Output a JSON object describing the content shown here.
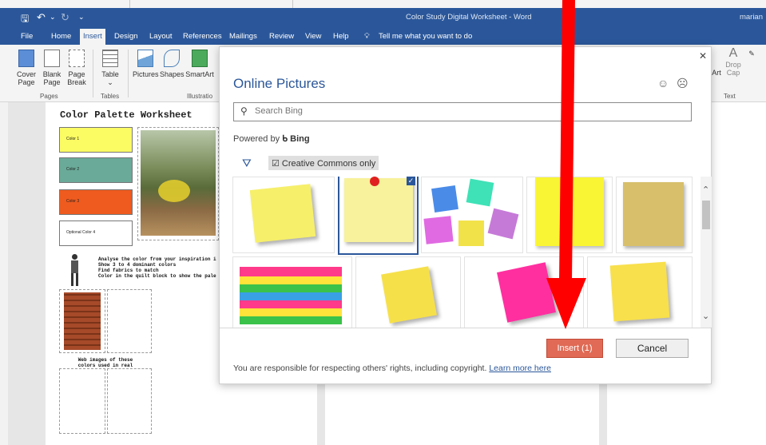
{
  "window": {
    "title": "Color Study Digital Worksheet  -  Word",
    "user": "marian"
  },
  "menu": {
    "tabs": [
      "File",
      "Home",
      "Insert",
      "Design",
      "Layout",
      "References",
      "Mailings",
      "Review",
      "View",
      "Help"
    ],
    "active": "Insert",
    "tell_me": "Tell me what you want to do"
  },
  "ribbon": {
    "cover_page": "Cover\nPage",
    "blank_page": "Blank\nPage",
    "page_break": "Page\nBreak",
    "table": "Table",
    "pictures": "Pictures",
    "shapes": "Shapes",
    "smartart": "SmartArt",
    "group_pages": "Pages",
    "group_tables": "Tables",
    "group_illustrations": "Illustratio",
    "right_art": "Art",
    "drop_cap": "Drop\nCap",
    "group_text": "Text"
  },
  "document": {
    "worksheet_title": "Color Palette Worksheet",
    "swatches": [
      {
        "label": "Color 1",
        "color": "#fbfb63"
      },
      {
        "label": "Color 2",
        "color": "#6aaa98"
      },
      {
        "label": "Color 3",
        "color": "#ef5b1f"
      },
      {
        "label": "Optional Color 4",
        "color": "#ffffff"
      }
    ],
    "instructions": [
      "Analyse the color from your inspiration i",
      "Show 3 to 4 dominant colors",
      "Find fabrics to match",
      "Color in the quilt block to show the pale"
    ],
    "web_images_caption": "Web images of these\ncolors used in real"
  },
  "dialog": {
    "title": "Online Pictures",
    "search_placeholder": "Search Bing",
    "powered_by": "Powered by",
    "bing": "Bing",
    "filter_chip": "Creative Commons only",
    "insert_button": "Insert (1)",
    "cancel_button": "Cancel",
    "footer": "You are responsible for respecting others' rights, including copyright.",
    "learn_more": "Learn more here"
  },
  "colors": {
    "word_blue": "#2b579a",
    "insert_button": "#e06a55",
    "arrow_red": "#ff0000"
  }
}
